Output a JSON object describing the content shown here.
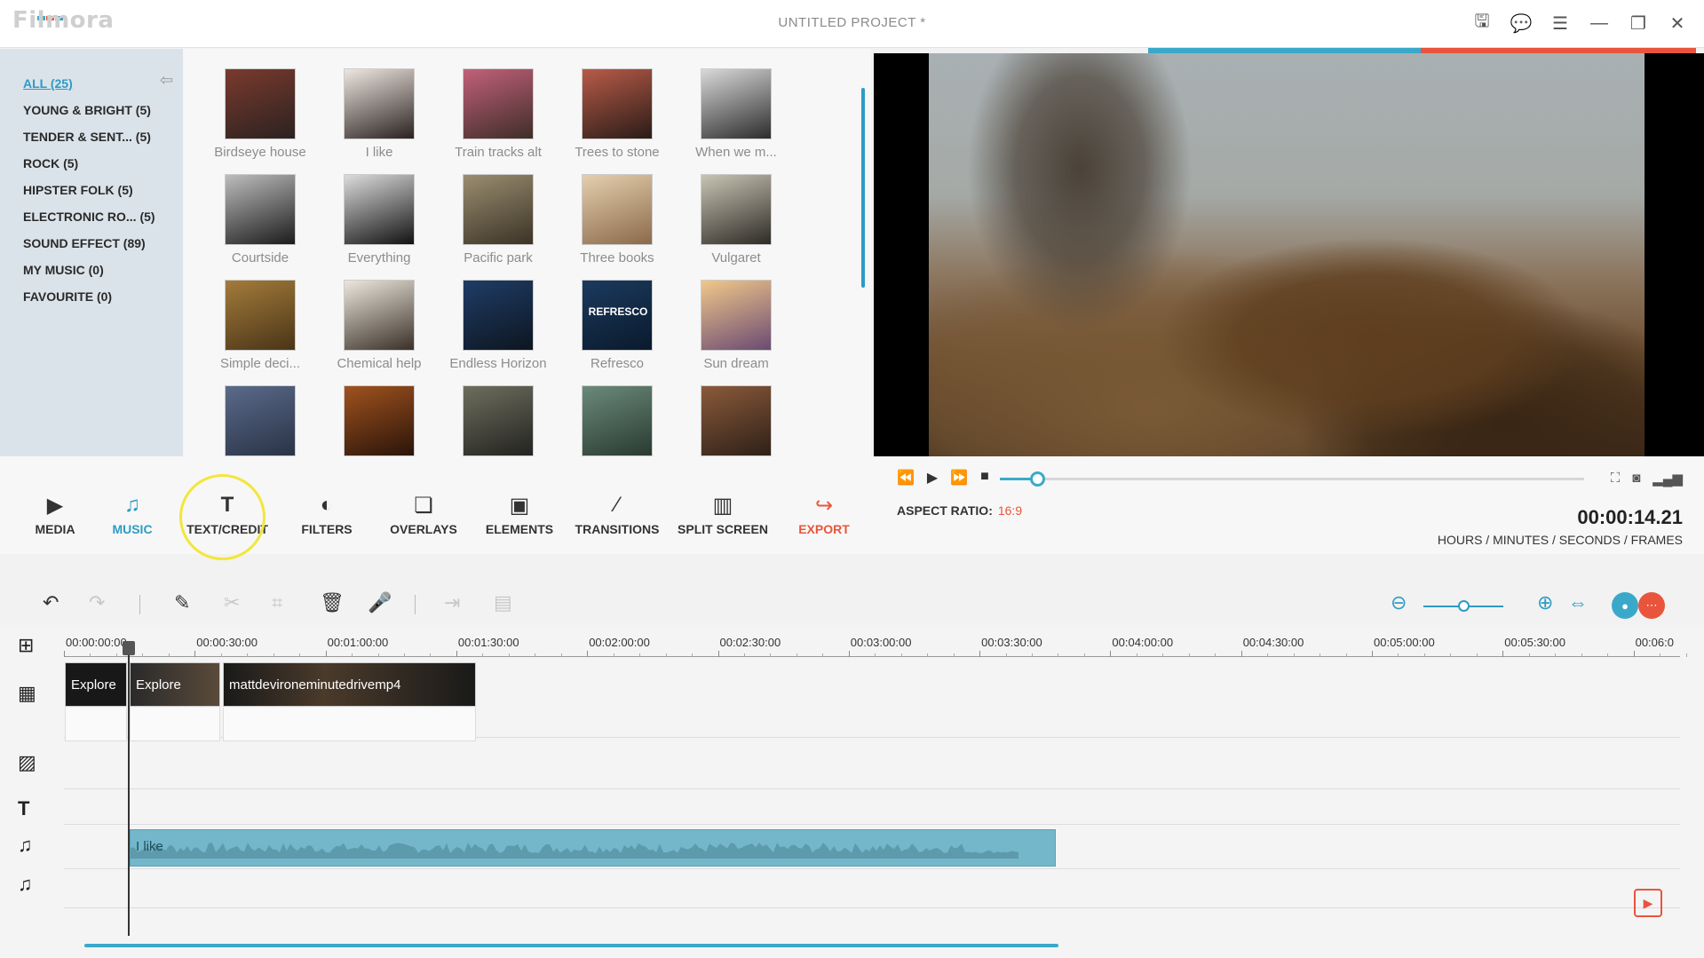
{
  "app": {
    "logo_text": "Filmora",
    "project_title": "UNTITLED PROJECT *"
  },
  "window_controls": [
    {
      "name": "save-icon",
      "glyph": "🖫"
    },
    {
      "name": "chat-icon",
      "glyph": "💬"
    },
    {
      "name": "menu-icon",
      "glyph": "☰"
    },
    {
      "name": "minimize-icon",
      "glyph": "—"
    },
    {
      "name": "restore-icon",
      "glyph": "❐"
    },
    {
      "name": "close-icon",
      "glyph": "✕"
    }
  ],
  "sidebar": {
    "items": [
      {
        "label": "ALL (25)",
        "active": true
      },
      {
        "label": "YOUNG & BRIGHT (5)"
      },
      {
        "label": "TENDER & SENT... (5)"
      },
      {
        "label": "ROCK (5)"
      },
      {
        "label": "HIPSTER FOLK (5)"
      },
      {
        "label": "ELECTRONIC RO... (5)"
      },
      {
        "label": "SOUND EFFECT (89)"
      },
      {
        "label": "MY MUSIC (0)"
      },
      {
        "label": "FAVOURITE (0)"
      }
    ]
  },
  "library": {
    "items": [
      {
        "label": "Birdseye house",
        "colors": [
          "#7a3a2e",
          "#2b2220"
        ]
      },
      {
        "label": "I like",
        "colors": [
          "#efe6e0",
          "#2a2220"
        ]
      },
      {
        "label": "Train tracks alt",
        "colors": [
          "#c2607a",
          "#3e2e28"
        ]
      },
      {
        "label": "Trees to stone",
        "colors": [
          "#b85b48",
          "#2a1c18"
        ]
      },
      {
        "label": "When we m...",
        "colors": [
          "#d9d9d9",
          "#2c2c2c"
        ]
      },
      {
        "label": "Courtside",
        "colors": [
          "#bdbdbd",
          "#1c1c1c"
        ]
      },
      {
        "label": "Everything",
        "colors": [
          "#dcdcdc",
          "#121212"
        ]
      },
      {
        "label": "Pacific park",
        "colors": [
          "#9a8d70",
          "#3b3326"
        ]
      },
      {
        "label": "Three books",
        "colors": [
          "#e4cfae",
          "#8b6a4a"
        ]
      },
      {
        "label": "Vulgaret",
        "colors": [
          "#c8c4b4",
          "#2e2b26"
        ]
      },
      {
        "label": "Simple deci...",
        "colors": [
          "#a37b3a",
          "#4a3518"
        ]
      },
      {
        "label": "Chemical help",
        "colors": [
          "#ece7dc",
          "#3a3028"
        ]
      },
      {
        "label": "Endless Horizon",
        "colors": [
          "#1f3c66",
          "#0d1620"
        ]
      },
      {
        "label": "Refresco",
        "colors": [
          "#1b3a5e",
          "#0a1a2c"
        ],
        "text": "REFRESCO"
      },
      {
        "label": "Sun dream",
        "colors": [
          "#f0c88a",
          "#6b4a73"
        ]
      },
      {
        "label": "",
        "colors": [
          "#5a6a8a",
          "#2a3346"
        ]
      },
      {
        "label": "",
        "colors": [
          "#a0521e",
          "#2a140a"
        ]
      },
      {
        "label": "",
        "colors": [
          "#6e6e5e",
          "#232320"
        ]
      },
      {
        "label": "",
        "colors": [
          "#6a8a7a",
          "#2a3a32"
        ]
      },
      {
        "label": "",
        "colors": [
          "#8a5a3a",
          "#2e2018"
        ]
      }
    ]
  },
  "toolbar": {
    "items": [
      {
        "label": "MEDIA",
        "icon": "▶",
        "name": "media"
      },
      {
        "label": "MUSIC",
        "icon": "♫",
        "name": "music",
        "active": true
      },
      {
        "label": "TEXT/CREDIT",
        "icon": "T",
        "name": "text-credit"
      },
      {
        "label": "FILTERS",
        "icon": "◐",
        "name": "filters"
      },
      {
        "label": "OVERLAYS",
        "icon": "❏",
        "name": "overlays"
      },
      {
        "label": "ELEMENTS",
        "icon": "▣",
        "name": "elements"
      },
      {
        "label": "TRANSITIONS",
        "icon": "⁄",
        "name": "transitions"
      },
      {
        "label": "SPLIT SCREEN",
        "icon": "▥",
        "name": "split-screen"
      },
      {
        "label": "EXPORT",
        "icon": "↪",
        "name": "export"
      }
    ]
  },
  "player": {
    "progress": 0.064,
    "aspect_label": "ASPECT RATIO:",
    "aspect_value": "16:9",
    "timecode": "00:00:14.21",
    "timecode_label": "HOURS / MINUTES / SECONDS / FRAMES"
  },
  "timeline": {
    "zoom": 0.5,
    "ruler_labels": [
      "00:00:00:00",
      "00:00:30:00",
      "00:01:00:00",
      "00:01:30:00",
      "00:02:00:00",
      "00:02:30:00",
      "00:03:00:00",
      "00:03:30:00",
      "00:04:00:00",
      "00:04:30:00",
      "00:05:00:00",
      "00:05:30:00",
      "00:06:0"
    ],
    "video_clips": [
      "Explore",
      "Explore",
      "mattdevironeminutedrivemp4"
    ],
    "audio_clip": "I like",
    "colors": {
      "accent": "#2d9bc4",
      "export": "#e8553c",
      "audio": "#74b7cb"
    }
  }
}
